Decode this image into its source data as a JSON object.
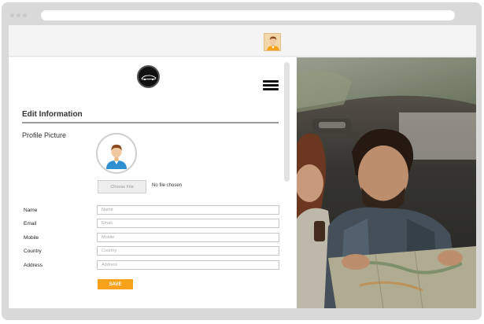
{
  "form": {
    "heading": "Edit Information",
    "profile_picture_label": "Profile Picture",
    "choose_file_label": "Choose File",
    "no_file_text": "No file chosen",
    "fields": {
      "name": {
        "label": "Name",
        "placeholder": "Name",
        "value": ""
      },
      "email": {
        "label": "Email",
        "placeholder": "Email",
        "value": ""
      },
      "mobile": {
        "label": "Mobile",
        "placeholder": "Mobile",
        "value": ""
      },
      "country": {
        "label": "Country",
        "placeholder": "Country",
        "value": ""
      },
      "address": {
        "label": "Address",
        "placeholder": "Address",
        "value": ""
      }
    },
    "save_label": "SAVE"
  },
  "icons": {
    "logo": "car-logo-icon",
    "menu": "hamburger-menu-icon",
    "top_avatar": "user-avatar-icon",
    "profile_avatar": "user-avatar-icon"
  },
  "colors": {
    "accent": "#f7a21a",
    "avatar_shirt": "#2f8fd1",
    "avatar_hair": "#8a4a20"
  }
}
